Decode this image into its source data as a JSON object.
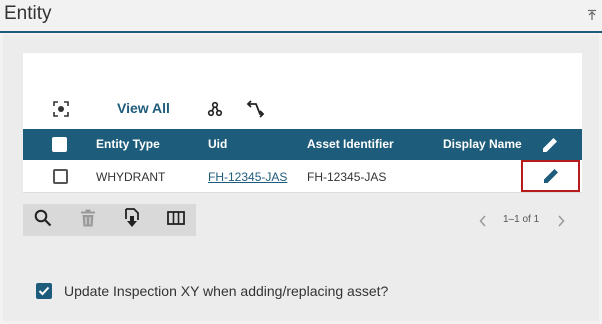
{
  "header": {
    "title": "Entity",
    "pin_icon": "pin-top-icon"
  },
  "toolbar": {
    "focus_icon": "focus-target-icon",
    "view_all_label": "View All",
    "hierarchy_icon": "hierarchy-icon",
    "swap_icon": "swap-arrows-icon"
  },
  "table": {
    "columns": [
      "Entity Type",
      "Uid",
      "Asset Identifier",
      "Display Name"
    ],
    "header_edit_icon": "pencil-icon",
    "rows": [
      {
        "entity_type": "WHYDRANT",
        "uid": "FH-12345-JAS",
        "asset_identifier": "FH-12345-JAS",
        "display_name": "",
        "edit_icon": "pencil-icon"
      }
    ]
  },
  "actions": {
    "search_icon": "search-icon",
    "delete_icon": "trash-icon",
    "export_icon": "file-download-icon",
    "columns_icon": "columns-icon"
  },
  "pager": {
    "text": "1–1 of 1",
    "prev_icon": "chevron-left-icon",
    "next_icon": "chevron-right-icon"
  },
  "update_option": {
    "label": "Update Inspection XY when adding/replacing asset?",
    "checked": true
  },
  "colors": {
    "accent": "#1e5c7b",
    "highlight_border": "#b71c1c",
    "panel_bg": "#ececec"
  }
}
